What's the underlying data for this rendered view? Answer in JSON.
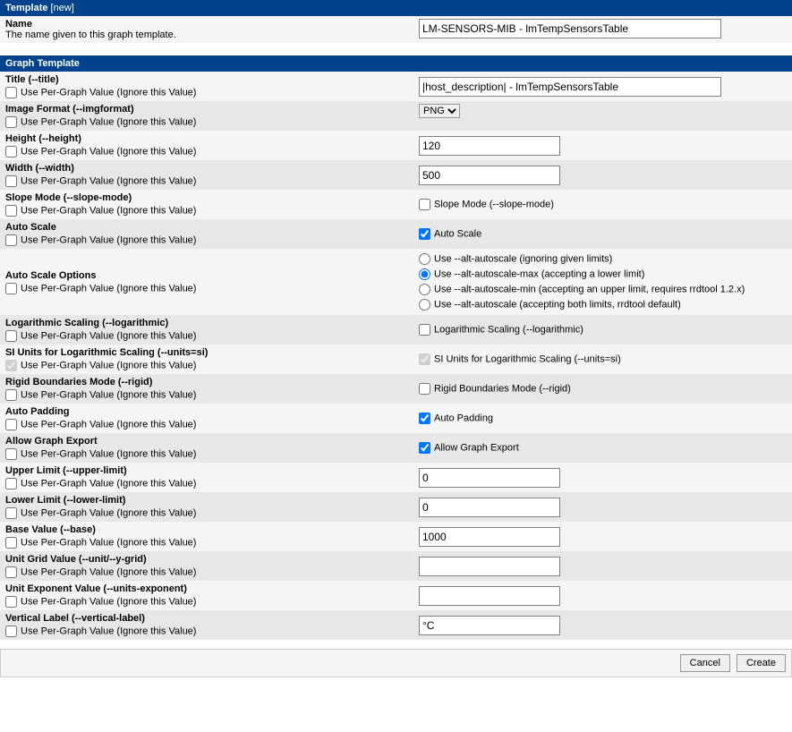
{
  "section1": {
    "title": "Template",
    "tag": "[new]"
  },
  "name_row": {
    "label": "Name",
    "desc": "The name given to this graph template.",
    "value": "LM-SENSORS-MIB - lmTempSensorsTable"
  },
  "section2": {
    "title": "Graph Template"
  },
  "perGraph": "Use Per-Graph Value (Ignore this Value)",
  "rows": {
    "title": {
      "label": "Title (--title)",
      "value": "|host_description| - lmTempSensorsTable"
    },
    "imgfmt": {
      "label": "Image Format (--imgformat)",
      "value": "PNG"
    },
    "height": {
      "label": "Height (--height)",
      "value": "120"
    },
    "width": {
      "label": "Width (--width)",
      "value": "500"
    },
    "slope": {
      "label": "Slope Mode (--slope-mode)",
      "cb": "Slope Mode (--slope-mode)"
    },
    "ascale": {
      "label": "Auto Scale",
      "cb": "Auto Scale"
    },
    "asopt": {
      "label": "Auto Scale Options",
      "o1": "Use --alt-autoscale (ignoring given limits)",
      "o2": "Use --alt-autoscale-max (accepting a lower limit)",
      "o3": "Use --alt-autoscale-min (accepting an upper limit, requires rrdtool 1.2.x)",
      "o4": "Use --alt-autoscale (accepting both limits, rrdtool default)"
    },
    "log": {
      "label": "Logarithmic Scaling (--logarithmic)",
      "cb": "Logarithmic Scaling (--logarithmic)"
    },
    "si": {
      "label": "SI Units for Logarithmic Scaling (--units=si)",
      "cb": "SI Units for Logarithmic Scaling (--units=si)"
    },
    "rigid": {
      "label": "Rigid Boundaries Mode (--rigid)",
      "cb": "Rigid Boundaries Mode (--rigid)"
    },
    "pad": {
      "label": "Auto Padding",
      "cb": "Auto Padding"
    },
    "export": {
      "label": "Allow Graph Export",
      "cb": "Allow Graph Export"
    },
    "upper": {
      "label": "Upper Limit (--upper-limit)",
      "value": "0"
    },
    "lower": {
      "label": "Lower Limit (--lower-limit)",
      "value": "0"
    },
    "base": {
      "label": "Base Value (--base)",
      "value": "1000"
    },
    "unit": {
      "label": "Unit Grid Value (--unit/--y-grid)",
      "value": ""
    },
    "uexp": {
      "label": "Unit Exponent Value (--units-exponent)",
      "value": ""
    },
    "vlabel": {
      "label": "Vertical Label (--vertical-label)",
      "value": "°C"
    }
  },
  "footer": {
    "cancel": "Cancel",
    "create": "Create"
  }
}
